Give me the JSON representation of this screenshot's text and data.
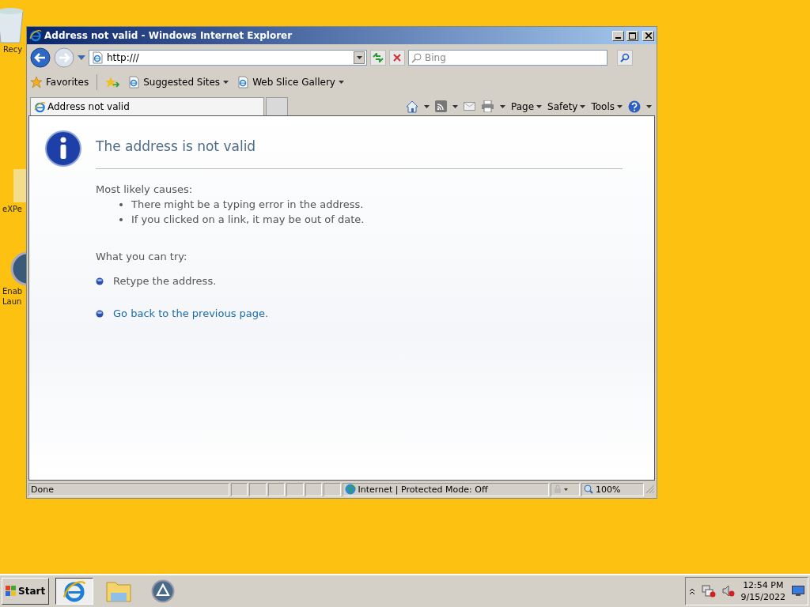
{
  "desktop_icons": [
    {
      "lines": [
        "Recy"
      ]
    },
    {
      "lines": [
        "eXPe"
      ]
    },
    {
      "lines": [
        "Enab",
        "Laun"
      ]
    }
  ],
  "window": {
    "title": "Address not valid - Windows Internet Explorer",
    "address": "http:///",
    "search_placeholder": "Bing",
    "favorites_bar": [
      {
        "label": "Favorites",
        "kind": "star"
      },
      {
        "label": "Suggested Sites",
        "kind": "menu"
      },
      {
        "label": "Web Slice Gallery",
        "kind": "menu"
      }
    ],
    "tabs": [
      {
        "label": "Address not valid",
        "selected": true
      }
    ],
    "command_bar": [
      "Page",
      "Safety",
      "Tools"
    ],
    "page": {
      "heading": "The address is not valid",
      "causes_title": "Most likely causes:",
      "causes": [
        "There might be a typing error in the address.",
        "If you clicked on a link, it may be out of date."
      ],
      "try_title": "What you can try:",
      "try_items": [
        {
          "kind": "text",
          "text": "Retype the address."
        },
        {
          "kind": "link",
          "text": "Go back to the previous page."
        }
      ]
    },
    "status_bar": {
      "text": "Done",
      "zone": "Internet | Protected Mode: Off",
      "zoom": "100%"
    }
  },
  "taskbar": {
    "start": "Start",
    "time": "12:54 PM",
    "date": "9/15/2022"
  }
}
